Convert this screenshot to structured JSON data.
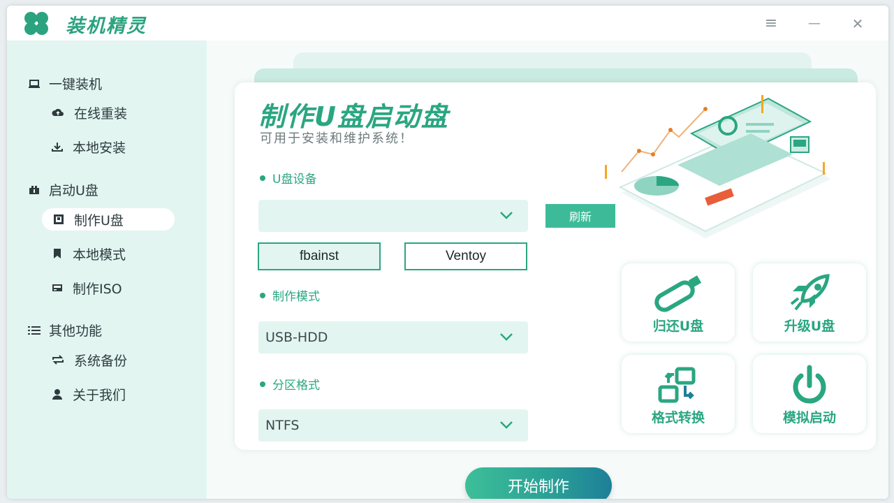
{
  "app": {
    "title": "装机精灵"
  },
  "window_controls": {
    "menu": "≡",
    "minimize": "—",
    "close": "✕"
  },
  "sidebar": {
    "groups": [
      {
        "label": "一键装机",
        "icon": "laptop-icon",
        "items": [
          {
            "label": "在线重装",
            "icon": "cloud-icon"
          },
          {
            "label": "本地安装",
            "icon": "download-icon"
          }
        ]
      },
      {
        "label": "启动U盘",
        "icon": "usb-drive-icon",
        "items": [
          {
            "label": "制作U盘",
            "icon": "square-icon",
            "active": true
          },
          {
            "label": "本地模式",
            "icon": "bookmark-icon"
          },
          {
            "label": "制作ISO",
            "icon": "disc-drive-icon"
          }
        ]
      },
      {
        "label": "其他功能",
        "icon": "list-icon",
        "items": [
          {
            "label": "系统备份",
            "icon": "sync-icon"
          },
          {
            "label": "关于我们",
            "icon": "user-icon"
          }
        ]
      }
    ]
  },
  "main": {
    "title": "制作U盘启动盘",
    "subtitle": "可用于安装和维护系统！",
    "usb_device": {
      "label": "U盘设备",
      "value": ""
    },
    "refresh_label": "刷新",
    "tools": [
      "fbainst",
      "Ventoy"
    ],
    "mode": {
      "label": "制作模式",
      "value": "USB-HDD"
    },
    "partition": {
      "label": "分区格式",
      "value": "NTFS"
    },
    "features": [
      {
        "label": "归还U盘",
        "icon": "usb-stick-icon"
      },
      {
        "label": "升级U盘",
        "icon": "rocket-icon"
      },
      {
        "label": "格式转换",
        "icon": "convert-icon"
      },
      {
        "label": "模拟启动",
        "icon": "power-icon"
      }
    ],
    "start_label": "开始制作"
  },
  "colors": {
    "accent": "#2aa681",
    "sidebar_bg": "#e3f5f1",
    "button": "#3dbb98"
  }
}
